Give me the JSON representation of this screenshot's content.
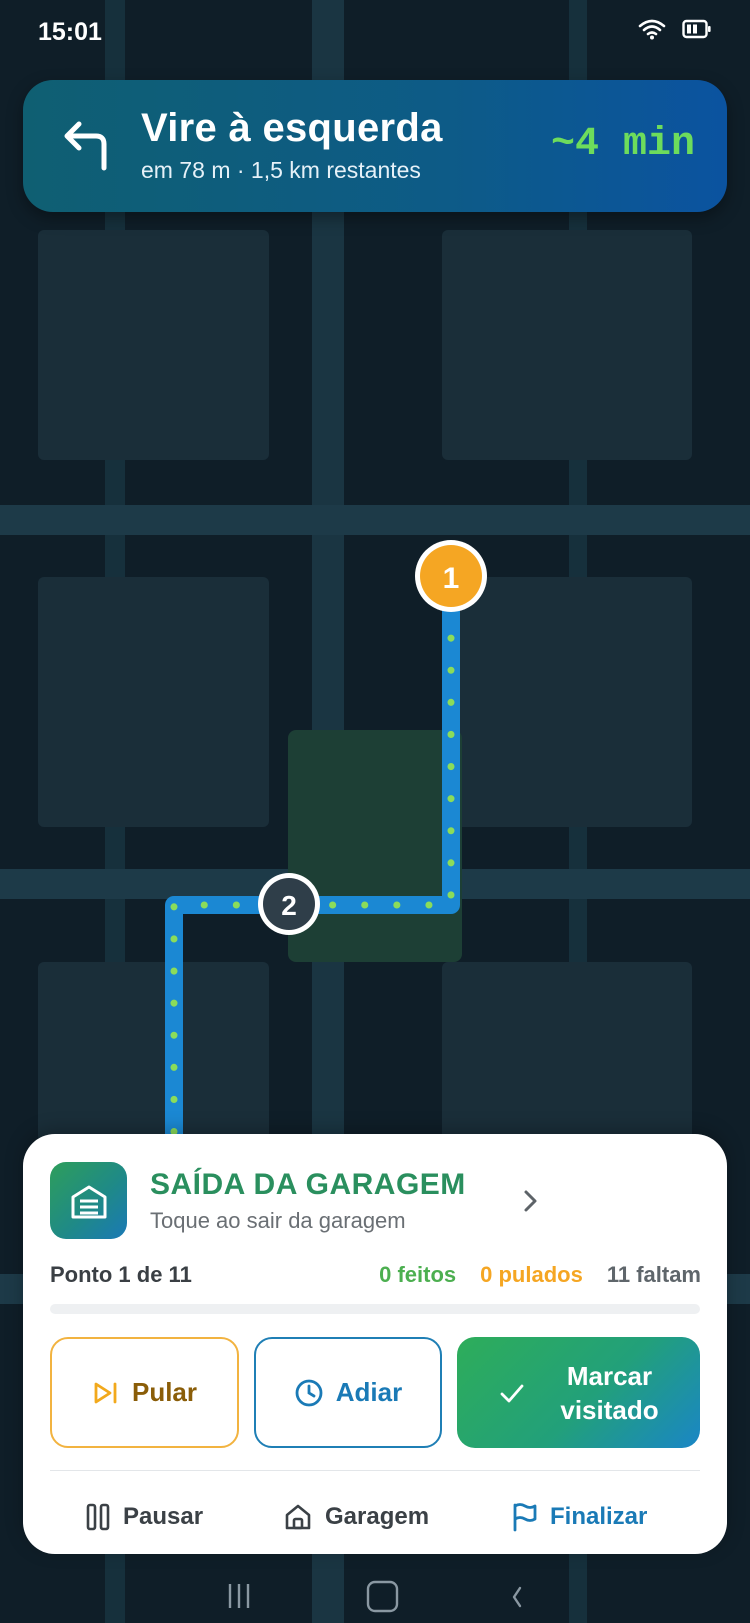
{
  "status_bar": {
    "time": "15:01",
    "icons": [
      "wifi-icon",
      "battery-icon"
    ]
  },
  "navigation": {
    "icon": "turn-left-arrow-icon",
    "instruction": "Vire à esquerda",
    "detail": "em 78 m · 1,5 km restantes",
    "eta": "~4 min"
  },
  "map": {
    "markers": [
      {
        "label": "1",
        "color": "#f5a623"
      },
      {
        "label": "2",
        "color": "#2f3e49"
      }
    ],
    "route_color": "#1b88d3",
    "route_dots_color": "#8bdc5a"
  },
  "stop_card": {
    "icon": "garage-icon",
    "title": "SAÍDA DA GARAGEM",
    "subtitle": "Toque ao sair da garagem",
    "progress_label": "Ponto 1 de 11",
    "progress_fraction": 0,
    "stats": {
      "done": "0 feitos",
      "skipped": "0 pulados",
      "remaining": "11 faltam"
    },
    "actions": {
      "skip": "Pular",
      "postpone": "Adiar",
      "visited_line1": "Marcar",
      "visited_line2": "visitado"
    },
    "footer": {
      "pause": "Pausar",
      "garage": "Garagem",
      "finish": "Finalizar"
    }
  },
  "colors": {
    "accent_green": "#4caf50",
    "accent_orange": "#f5a623",
    "accent_blue": "#1a7ab6",
    "eta_green": "#6ddc5c"
  }
}
